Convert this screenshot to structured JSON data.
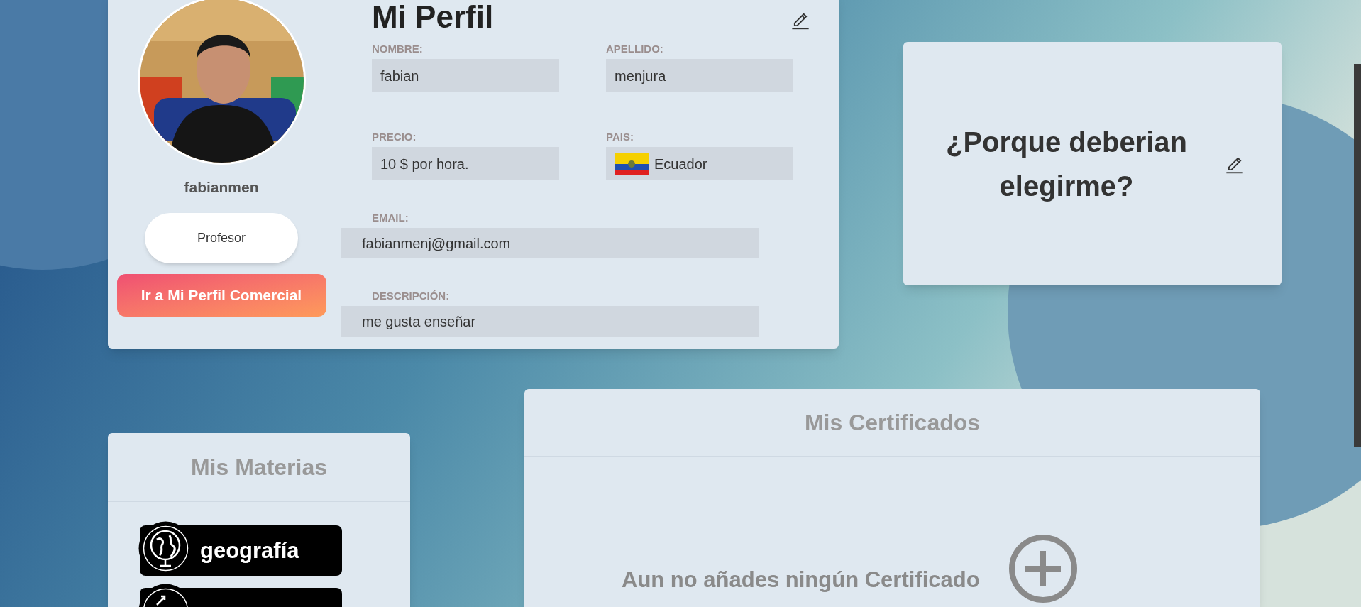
{
  "profile": {
    "title": "Mi Perfil",
    "username": "fabianmen",
    "role_button": "Profesor",
    "commercial_button": "Ir a Mi Perfil Comercial",
    "fields": [
      {
        "label": "NOMBRE:",
        "value": "fabian",
        "kind": "text"
      },
      {
        "label": "APELLIDO:",
        "value": "menjura",
        "kind": "text"
      },
      {
        "label": "PRECIO:",
        "value": "10 $ por hora.",
        "kind": "text"
      },
      {
        "label": "PAIS:",
        "value": "Ecuador",
        "kind": "country"
      },
      {
        "label": "EMAIL:",
        "value": "fabianmenj@gmail.com",
        "kind": "wide"
      },
      {
        "label": "DESCRIPCIÓN:",
        "value": "me gusta enseñar",
        "kind": "wide"
      }
    ]
  },
  "why_card": {
    "title": "¿Porque deberian elegirme?"
  },
  "subjects": {
    "title": "Mis Materias",
    "items": [
      {
        "label": "geografía",
        "kind": "globe"
      },
      {
        "kind": "chart"
      }
    ]
  },
  "certificates": {
    "title": "Mis Certificados",
    "empty_text": "Aun no añades ningún Certificado"
  }
}
